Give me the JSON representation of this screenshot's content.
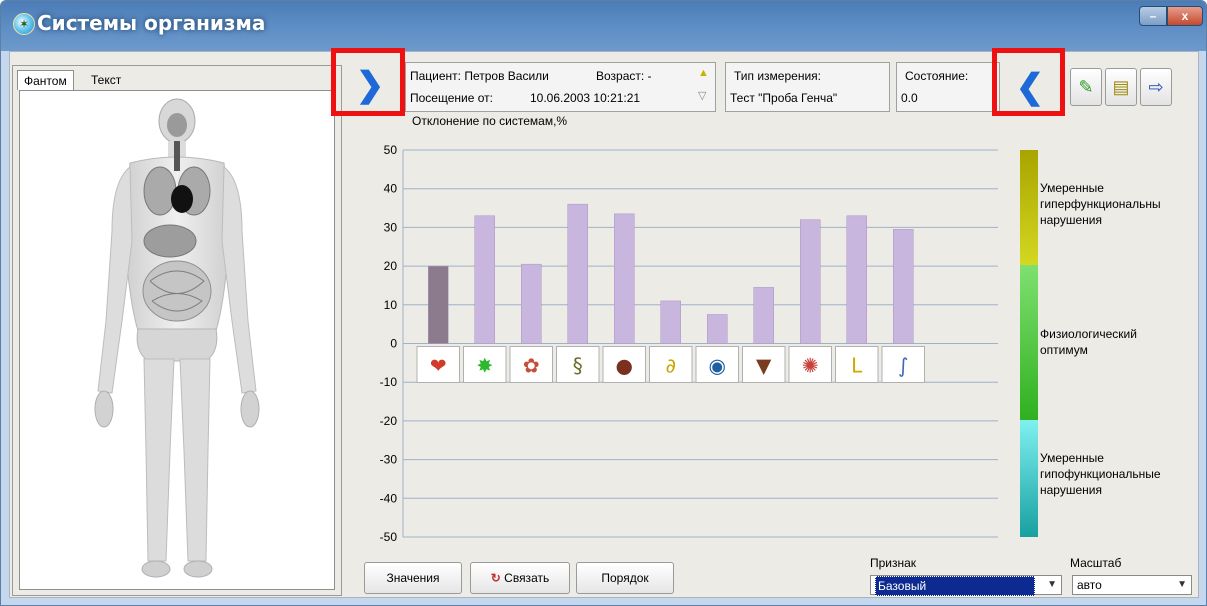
{
  "window": {
    "title": "Системы организма",
    "minimize": "–",
    "close": "x"
  },
  "tabs": [
    {
      "label": "Фантом"
    },
    {
      "label": "Текст"
    }
  ],
  "patient": {
    "patient_line": "Пациент: Петров Васили",
    "age_label": "Возраст: -",
    "visit_label": "Посещение от:",
    "visit_datetime": "10.06.2003  10:21:21"
  },
  "measurement": {
    "label": "Тип измерения:",
    "value": "Тест \"Проба Генча\""
  },
  "state": {
    "label": "Состояние:",
    "value": "0.0"
  },
  "icons": {
    "expand": "chevron-right-icon",
    "collapse": "chevron-left-icon",
    "tool1": "edit-icon",
    "tool2": "note-icon",
    "tool3": "exit-icon"
  },
  "legend": {
    "upper": [
      "Умеренные",
      "гиперфункциональны",
      "нарушения"
    ],
    "middle": [
      "Физиологический",
      "оптимум"
    ],
    "lower": [
      "Умеренные",
      "гипофункциональные",
      "нарушения"
    ],
    "colors": {
      "upper": "#d4d820",
      "middle": "#3cc830",
      "lower": "#2ec0c0"
    }
  },
  "chart_data": {
    "type": "bar",
    "title": "Отклонение по системам,%",
    "ylim": [
      -50,
      50
    ],
    "yticks": [
      50,
      40,
      30,
      20,
      10,
      0,
      -10,
      -20,
      -30,
      -40,
      -50
    ],
    "categories": [
      "heart",
      "nervous",
      "lungs",
      "intestine",
      "kidney",
      "ear",
      "eye",
      "urogenital",
      "brain",
      "joints",
      "spine"
    ],
    "values": [
      20,
      33,
      20.5,
      36,
      33.5,
      11,
      7.5,
      14.5,
      32,
      33,
      29.5
    ],
    "bar_color": "#c8b6df",
    "first_bar_color": "#8b7b8d"
  },
  "bottom": {
    "values_btn": "Значения",
    "link_btn": "Связать",
    "order_btn": "Порядок",
    "sign_label": "Признак",
    "sign_value": "Базовый",
    "scale_label": "Масштаб",
    "scale_value": "авто"
  }
}
